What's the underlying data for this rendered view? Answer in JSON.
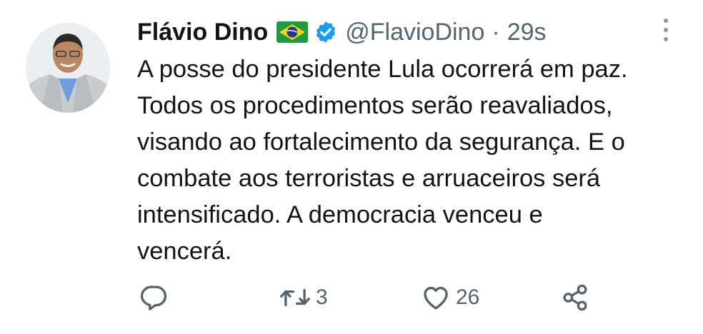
{
  "tweet": {
    "author_name": "Flávio Dino",
    "handle": "@FlavioDino",
    "separator": "·",
    "timestamp": "29s",
    "text_lines": [
      "A posse do presidente Lula ocorrerá em paz.",
      "Todos os procedimentos serão reavaliados,",
      "visando ao fortalecimento da segurança. E o",
      "combate aos terroristas e arruaceiros será",
      "intensificado. A democracia venceu e",
      "vencerá."
    ],
    "icons": {
      "flag": "brazil-flag-icon",
      "verified": "verified-badge-icon",
      "more": "more-options-icon",
      "reply": "reply-icon",
      "retweet": "retweet-icon",
      "like": "like-icon",
      "share": "share-icon"
    },
    "actions": {
      "reply_count": "",
      "retweet_count": "3",
      "like_count": "26"
    },
    "colors": {
      "text": "#0f1419",
      "secondary": "#536471",
      "verified": "#1d9bf0"
    }
  }
}
